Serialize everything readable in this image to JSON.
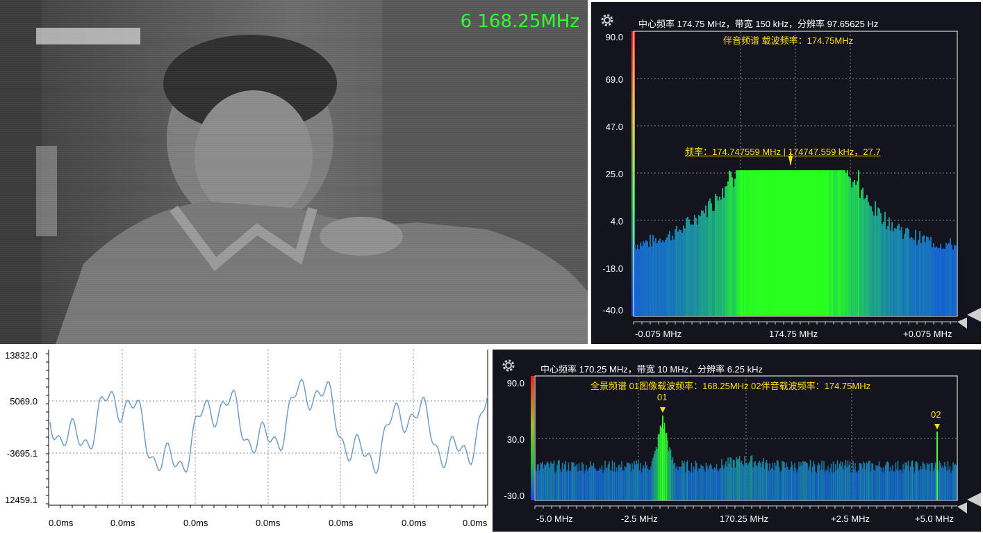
{
  "video": {
    "frequency_overlay": "6 168.25MHz"
  },
  "spectrum_sound": {
    "header": "中心频率 174.75 MHz，带宽 150 kHz，分辨率 97.65625 Hz",
    "subtitle": "伴音频谱    载波频率：174.75MHz",
    "marker": "频率：174.747559 MHz | 174747.559 kHz，27.7",
    "yticks": [
      "90.0",
      "69.0",
      "47.0",
      "25.0",
      "4.0",
      "-18.0",
      "-40.0"
    ],
    "xticks": [
      "-0.075 MHz",
      "174.75 MHz",
      "+0.075 MHz"
    ],
    "icon": "gear-icon"
  },
  "spectrum_full": {
    "header": "中心频率 170.25 MHz，带宽 10 MHz，分辨率 6.25 kHz",
    "subtitle": "全景频谱    01图像载波频率：168.25MHz    02伴音载波频率：174.75MHz",
    "marker1": "01",
    "marker2": "02",
    "yticks": [
      "90.0",
      "30.0",
      "-30.0"
    ],
    "xticks": [
      "-5.0 MHz",
      "-2.5 MHz",
      "170.25 MHz",
      "+2.5 MHz",
      "+5.0 MHz"
    ],
    "icon": "gear-icon"
  },
  "waveform": {
    "yticks": [
      "13832.0",
      "5069.0",
      "-3695.1",
      "12459.1"
    ],
    "xticks": [
      "0.0ms",
      "0.0ms",
      "0.0ms",
      "0.0ms",
      "0.0ms",
      "0.0ms",
      "0.0ms"
    ]
  },
  "colors": {
    "panel_bg": "#14141f",
    "accent_yellow": "#ffe000",
    "overlay_green": "#33ff33",
    "trace": "#a0c4e8"
  }
}
